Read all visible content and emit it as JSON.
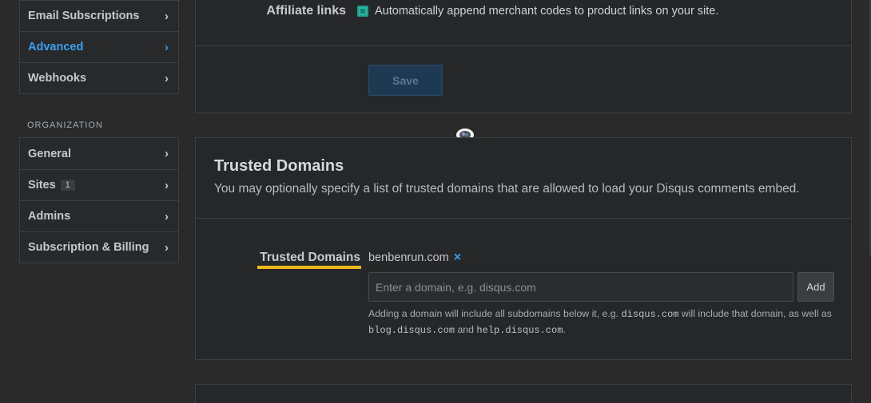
{
  "sidebar": {
    "settings_items": [
      {
        "label": "Email Subscriptions",
        "active": false
      },
      {
        "label": "Advanced",
        "active": true
      },
      {
        "label": "Webhooks",
        "active": false
      }
    ],
    "org_section_label": "ORGANIZATION",
    "org_items": [
      {
        "label": "General"
      },
      {
        "label": "Sites",
        "badge": "1"
      },
      {
        "label": "Admins"
      },
      {
        "label": "Subscription & Billing"
      }
    ],
    "chevron": "›"
  },
  "affiliate": {
    "label": "Affiliate links",
    "checkbox_text": "Automatically append merchant codes to product links on your site.",
    "checked": true,
    "save_label": "Save"
  },
  "trusted": {
    "title": "Trusted Domains",
    "description": "You may optionally specify a list of trusted domains that are allowed to load your Disqus comments embed.",
    "field_label": "Trusted Domains",
    "domains": [
      "benbenrun.com"
    ],
    "remove_glyph": "×",
    "input_placeholder": "Enter a domain, e.g. disqus.com",
    "input_value": "",
    "add_label": "Add",
    "help_prefix": "Adding a domain will include all subdomains below it, e.g. ",
    "help_code1": "disqus.com",
    "help_middle": " will include that domain, as well as",
    "help_code2": "blog.disqus.com",
    "help_and": " and ",
    "help_code3": "help.disqus.com",
    "help_suffix": "."
  },
  "colors": {
    "accent": "#3aa0ee",
    "underline": "#f0b91a",
    "checkbox": "#27b89f"
  }
}
